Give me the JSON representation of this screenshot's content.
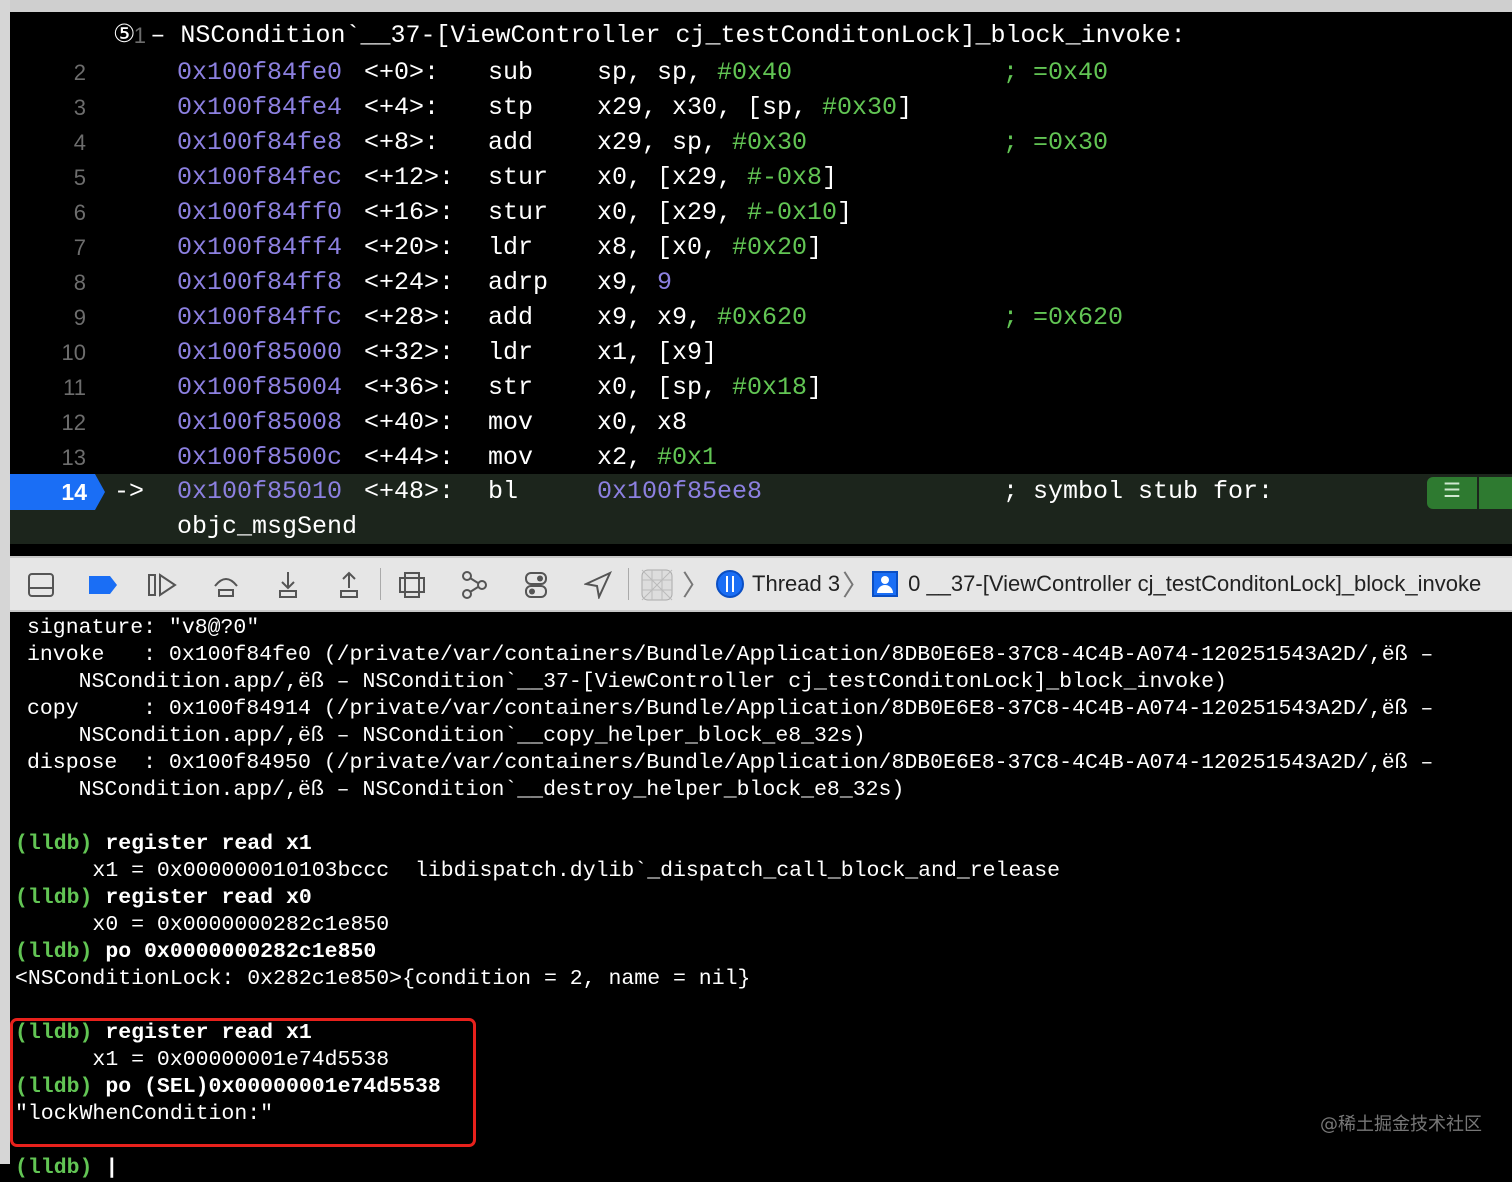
{
  "disassembly": {
    "header": {
      "num": "1",
      "text": "⑤ – NSCondition`__37-[ViewController cj_testConditonLock]_block_invoke:"
    },
    "lines": [
      {
        "num": "2",
        "addr": "0x100f84fe0",
        "off": "<+0>:",
        "mn": "sub",
        "ops": [
          [
            "sp, sp, ",
            ""
          ],
          [
            "#0x40",
            "g"
          ]
        ],
        "cm": [
          [
            "; ",
            "g"
          ],
          [
            "=0x40",
            "g"
          ]
        ]
      },
      {
        "num": "3",
        "addr": "0x100f84fe4",
        "off": "<+4>:",
        "mn": "stp",
        "ops": [
          [
            "x29, x30, [sp, ",
            ""
          ],
          [
            "#0x30",
            "g"
          ],
          [
            "]",
            ""
          ]
        ]
      },
      {
        "num": "4",
        "addr": "0x100f84fe8",
        "off": "<+8>:",
        "mn": "add",
        "ops": [
          [
            "x29, sp, ",
            ""
          ],
          [
            "#0x30",
            "g"
          ]
        ],
        "cm": [
          [
            "; ",
            "g"
          ],
          [
            "=0x30",
            "g"
          ]
        ]
      },
      {
        "num": "5",
        "addr": "0x100f84fec",
        "off": "<+12>:",
        "mn": "stur",
        "ops": [
          [
            "x0, [x29, ",
            ""
          ],
          [
            "#-0x8",
            "g"
          ],
          [
            "]",
            ""
          ]
        ]
      },
      {
        "num": "6",
        "addr": "0x100f84ff0",
        "off": "<+16>:",
        "mn": "stur",
        "ops": [
          [
            "x0, [x29, ",
            ""
          ],
          [
            "#-0x10",
            "g"
          ],
          [
            "]",
            ""
          ]
        ]
      },
      {
        "num": "7",
        "addr": "0x100f84ff4",
        "off": "<+20>:",
        "mn": "ldr",
        "ops": [
          [
            "x8, [x0, ",
            ""
          ],
          [
            "#0x20",
            "g"
          ],
          [
            "]",
            ""
          ]
        ]
      },
      {
        "num": "8",
        "addr": "0x100f84ff8",
        "off": "<+24>:",
        "mn": "adrp",
        "ops": [
          [
            "x9, ",
            ""
          ],
          [
            "9",
            "p"
          ]
        ]
      },
      {
        "num": "9",
        "addr": "0x100f84ffc",
        "off": "<+28>:",
        "mn": "add",
        "ops": [
          [
            "x9, x9, ",
            ""
          ],
          [
            "#0x620",
            "g"
          ]
        ],
        "cm": [
          [
            "; ",
            "g"
          ],
          [
            "=0x620",
            "g"
          ]
        ]
      },
      {
        "num": "10",
        "addr": "0x100f85000",
        "off": "<+32>:",
        "mn": "ldr",
        "ops": [
          [
            "x1, [x9]",
            ""
          ]
        ]
      },
      {
        "num": "11",
        "addr": "0x100f85004",
        "off": "<+36>:",
        "mn": "str",
        "ops": [
          [
            "x0, [sp, ",
            ""
          ],
          [
            "#0x18",
            "g"
          ],
          [
            "]",
            ""
          ]
        ]
      },
      {
        "num": "12",
        "addr": "0x100f85008",
        "off": "<+40>:",
        "mn": "mov",
        "ops": [
          [
            "x0, x8",
            ""
          ]
        ]
      },
      {
        "num": "13",
        "addr": "0x100f8500c",
        "off": "<+44>:",
        "mn": "mov",
        "ops": [
          [
            "x2, ",
            ""
          ],
          [
            "#0x1",
            "g"
          ]
        ]
      }
    ],
    "current": {
      "num": "14",
      "arrow": "->",
      "addr": "0x100f85010",
      "off": "<+48>:",
      "mn": "bl",
      "target": "0x100f85ee8",
      "cm": "; symbol stub for:",
      "cont": "objc_msgSend",
      "badge_icon": "lines-icon"
    }
  },
  "toolbar": {
    "thread": "Thread 3",
    "frame": "0 __37-[ViewController cj_testConditonLock]_block_invoke",
    "icons": [
      "hide-debug-area-icon",
      "breakpoints-toggle-icon",
      "continue-icon",
      "step-over-icon",
      "step-into-icon",
      "step-out-icon",
      "view-hierarchy-icon",
      "memory-graph-icon",
      "environment-overrides-icon",
      "simulate-location-icon",
      "app-icon",
      "thread-icon",
      "frame-user-icon"
    ]
  },
  "console": {
    "lines": [
      {
        "t": "o",
        "text": "signature: \"v8@?0\""
      },
      {
        "t": "o",
        "text": "invoke   : 0x100f84fe0 (/private/var/containers/Bundle/Application/8DB0E6E8-37C8-4C4B-A074-120251543A2D/,ëß –"
      },
      {
        "t": "o",
        "text": "    NSCondition.app/,ëß – NSCondition`__37-[ViewController cj_testConditonLock]_block_invoke)"
      },
      {
        "t": "o",
        "text": "copy     : 0x100f84914 (/private/var/containers/Bundle/Application/8DB0E6E8-37C8-4C4B-A074-120251543A2D/,ëß –"
      },
      {
        "t": "o",
        "text": "    NSCondition.app/,ëß – NSCondition`__copy_helper_block_e8_32s)"
      },
      {
        "t": "o",
        "text": "dispose  : 0x100f84950 (/private/var/containers/Bundle/Application/8DB0E6E8-37C8-4C4B-A074-120251543A2D/,ëß –"
      },
      {
        "t": "o",
        "text": "    NSCondition.app/,ëß – NSCondition`__destroy_helper_block_e8_32s)"
      },
      {
        "t": "o",
        "text": ""
      },
      {
        "t": "p",
        "prompt": "(lldb)",
        "text": "register read x1"
      },
      {
        "t": "o",
        "text": "      x1 = 0x000000010103bccc  libdispatch.dylib`_dispatch_call_block_and_release"
      },
      {
        "t": "p",
        "prompt": "(lldb)",
        "text": "register read x0"
      },
      {
        "t": "o",
        "text": "      x0 = 0x0000000282c1e850"
      },
      {
        "t": "p",
        "prompt": "(lldb)",
        "text": "po 0x0000000282c1e850"
      },
      {
        "t": "o",
        "text": "<NSConditionLock: 0x282c1e850>{condition = 2, name = nil}"
      },
      {
        "t": "o",
        "text": ""
      },
      {
        "t": "p",
        "prompt": "(lldb)",
        "text": "register read x1"
      },
      {
        "t": "o",
        "text": "      x1 = 0x00000001e74d5538"
      },
      {
        "t": "p",
        "prompt": "(lldb)",
        "text": "po (SEL)0x00000001e74d5538"
      },
      {
        "t": "o",
        "text": "\"lockWhenCondition:\""
      },
      {
        "t": "o",
        "text": ""
      },
      {
        "t": "p",
        "prompt": "(lldb)",
        "text": "|"
      }
    ]
  },
  "watermark": "@稀土掘金技术社区",
  "colors": {
    "address": "#8c80e0",
    "immediate": "#62c554",
    "current_line": "#1a6ef5",
    "highlight_box": "#e8211c"
  }
}
